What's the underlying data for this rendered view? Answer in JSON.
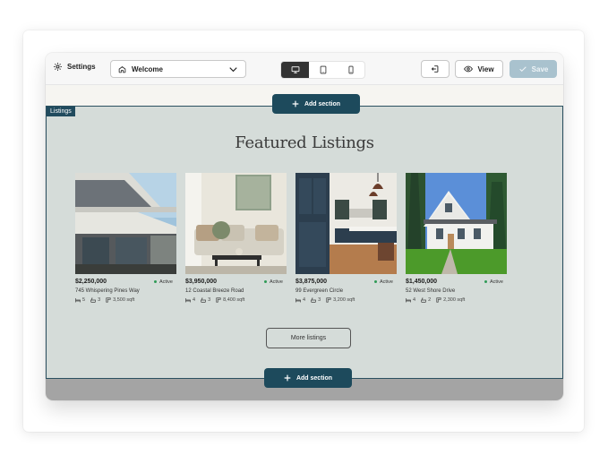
{
  "toolbar": {
    "settings_label": "Settings",
    "page_select_value": "Welcome",
    "devices": [
      "desktop-icon",
      "tablet-icon",
      "mobile-icon"
    ],
    "active_device": "desktop",
    "view_label": "View",
    "save_label": "Save"
  },
  "section": {
    "tag": "Listings",
    "title": "Featured Listings",
    "add_section_label": "Add section",
    "more_label": "More listings"
  },
  "listings": [
    {
      "price": "$2,250,000",
      "status": "Active",
      "address": "745 Whispering Pines Way",
      "beds": "5",
      "baths": "3",
      "sqft": "3,500 sqft"
    },
    {
      "price": "$3,950,000",
      "status": "Active",
      "address": "12 Coastal Breeze Road",
      "beds": "4",
      "baths": "3",
      "sqft": "8,400 sqft"
    },
    {
      "price": "$3,875,000",
      "status": "Active",
      "address": "99 Evergreen Circle",
      "beds": "4",
      "baths": "3",
      "sqft": "3,200 sqft"
    },
    {
      "price": "$1,450,000",
      "status": "Active",
      "address": "52 West Shore Drive",
      "beds": "4",
      "baths": "2",
      "sqft": "2,300 sqft"
    }
  ],
  "colors": {
    "accent": "#1d4a5c",
    "section_bg": "#d5dcd9",
    "active_dot": "#2f9b57",
    "save_disabled": "#a9c2ce"
  }
}
